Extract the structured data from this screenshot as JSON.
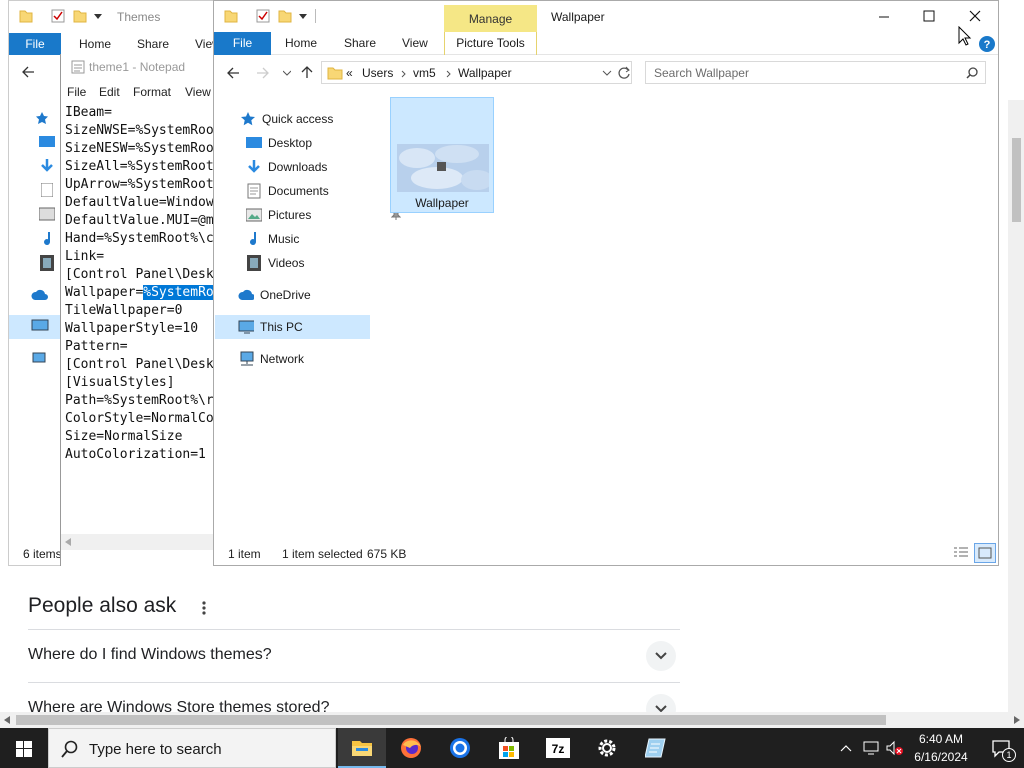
{
  "browser": {
    "people_also_ask": "People also ask",
    "questions": [
      "Where do I find Windows themes?",
      "Where are Windows Store themes stored?"
    ]
  },
  "themes_window": {
    "title": "Themes",
    "tabs": [
      "File",
      "Home",
      "Share",
      "View"
    ],
    "status": "6 items"
  },
  "notepad": {
    "title": "theme1 - Notepad",
    "menu": [
      "File",
      "Edit",
      "Format",
      "View"
    ],
    "lines": [
      "IBeam=",
      "SizeNWSE=%SystemRoo",
      "SizeNESW=%SystemRoo",
      "SizeAll=%SystemRoot",
      "UpArrow=%SystemRoot",
      "DefaultValue=Window",
      "DefaultValue.MUI=@m",
      "Hand=%SystemRoot%\\c",
      "Link=",
      "",
      "[Control Panel\\Desk",
      "Wallpaper=",
      "TileWallpaper=0",
      "WallpaperStyle=10",
      "Pattern=",
      "",
      "[Control Panel\\Desk",
      "",
      "[VisualStyles]",
      "Path=%SystemRoot%\\r",
      "ColorStyle=NormalCo",
      "Size=NormalSize",
      "AutoColorization=1"
    ],
    "selected_text": "%SystemRo"
  },
  "explorer": {
    "title": "Wallpaper",
    "manage_tab": "Manage",
    "picture_tools_tab": "Picture Tools",
    "tabs": [
      "File",
      "Home",
      "Share",
      "View"
    ],
    "breadcrumb": [
      "«",
      "Users",
      "vm5",
      "Wallpaper"
    ],
    "search_placeholder": "Search Wallpaper",
    "nav": {
      "quick_access": "Quick access",
      "desktop": "Desktop",
      "downloads": "Downloads",
      "documents": "Documents",
      "pictures": "Pictures",
      "music": "Music",
      "videos": "Videos",
      "onedrive": "OneDrive",
      "this_pc": "This PC",
      "network": "Network"
    },
    "file_label": "Wallpaper",
    "status_count": "1 item",
    "status_selected": "1 item selected",
    "status_size": "675 KB"
  },
  "taskbar": {
    "search_placeholder": "Type here to search",
    "time": "6:40 AM",
    "date": "6/16/2024",
    "notification_count": "1"
  }
}
